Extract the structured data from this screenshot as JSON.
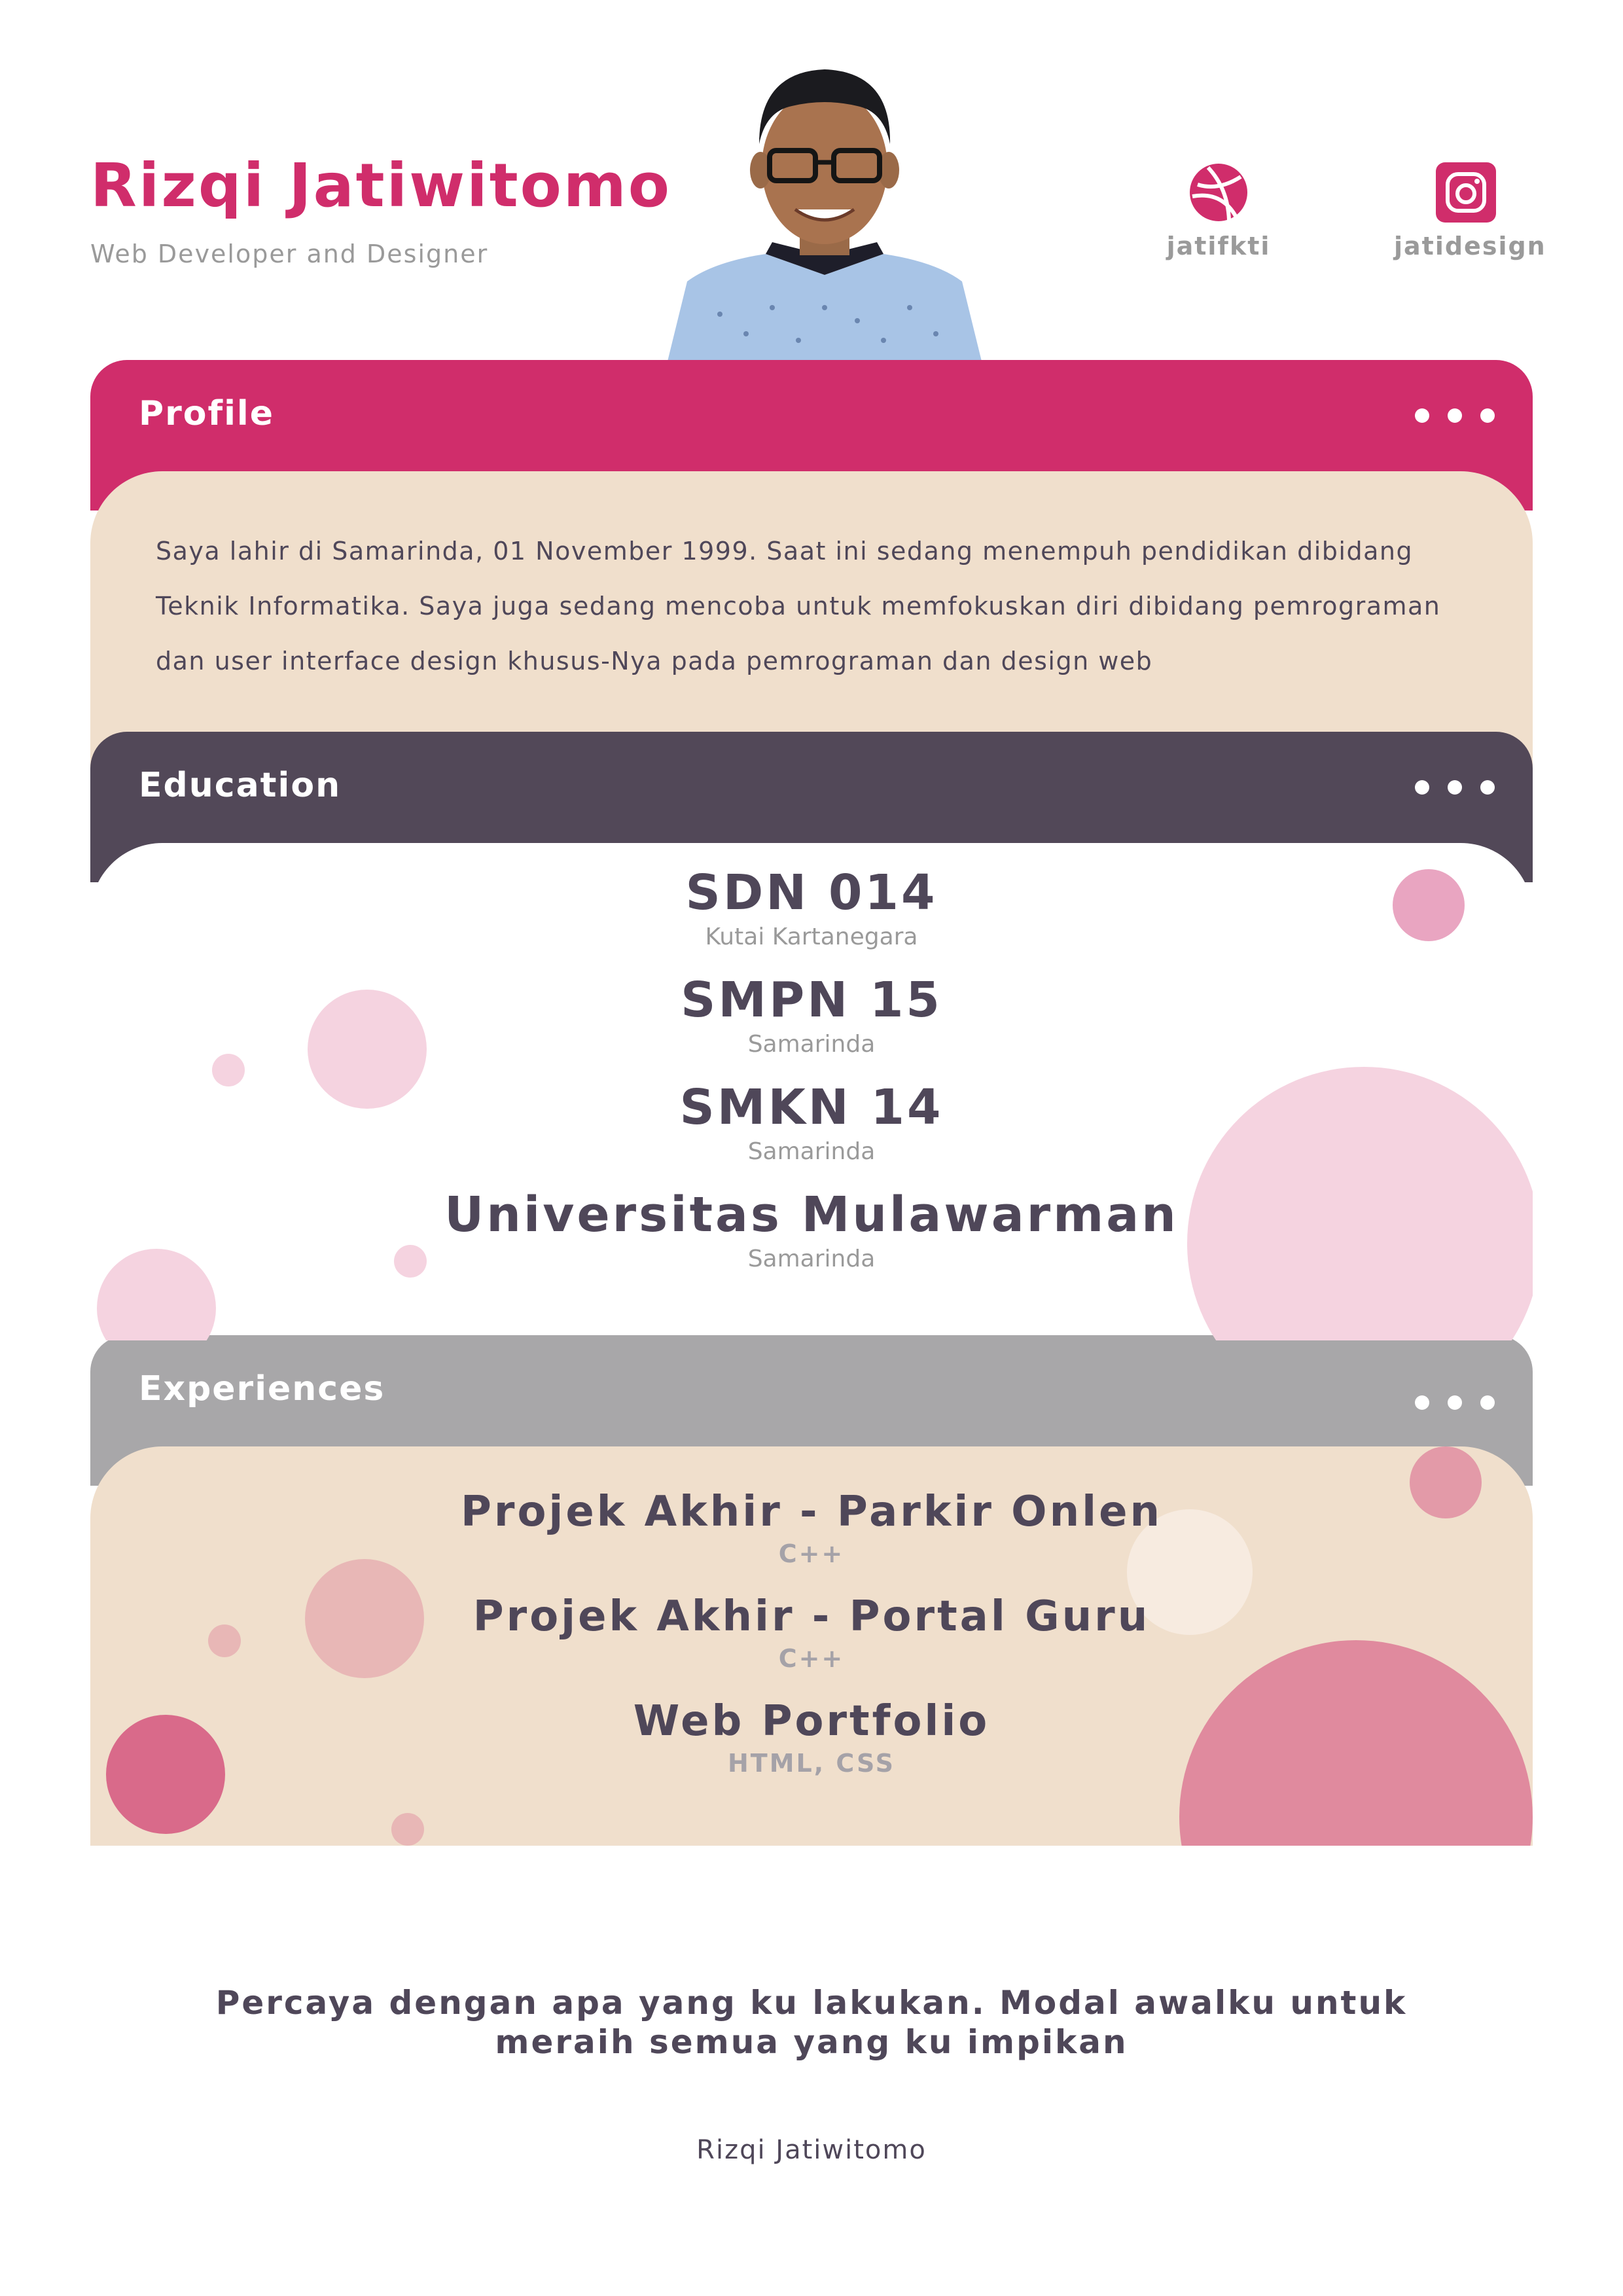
{
  "header": {
    "name": "Rizqi Jatiwitomo",
    "role": "Web Developer and Designer",
    "photo": "portrait-photo"
  },
  "social": [
    {
      "icon": "dribbble-icon",
      "handle": "jatifkti"
    },
    {
      "icon": "instagram-icon",
      "handle": "jatidesign"
    }
  ],
  "profile": {
    "title": "Profile",
    "text": "Saya lahir di Samarinda, 01 November 1999. Saat ini sedang menempuh pendidikan dibidang Teknik Informatika. Saya juga sedang mencoba untuk memfokuskan diri dibidang pemrograman dan user interface design khusus-Nya pada pemrograman dan design web"
  },
  "education": {
    "title": "Education",
    "items": [
      {
        "name": "SDN 014",
        "place": "Kutai Kartanegara"
      },
      {
        "name": "SMPN 15",
        "place": "Samarinda"
      },
      {
        "name": "SMKN 14",
        "place": "Samarinda"
      },
      {
        "name": "Universitas Mulawarman",
        "place": "Samarinda"
      }
    ]
  },
  "experiences": {
    "title": "Experiences",
    "items": [
      {
        "name": "Projek Akhir - Parkir Onlen",
        "tech": "C++"
      },
      {
        "name": "Projek Akhir - Portal Guru",
        "tech": "C++"
      },
      {
        "name": "Web Portfolio",
        "tech": "HTML, CSS"
      }
    ]
  },
  "footer": {
    "quote_line1": "Percaya dengan apa yang ku lakukan. Modal awalku untuk",
    "quote_line2": "meraih semua yang ku impikan",
    "signature": "Rizqi Jatiwitomo"
  },
  "colors": {
    "accent": "#d02d6b",
    "dark": "#524858",
    "gray": "#a8a7a9",
    "cream": "#f0dfcc"
  }
}
